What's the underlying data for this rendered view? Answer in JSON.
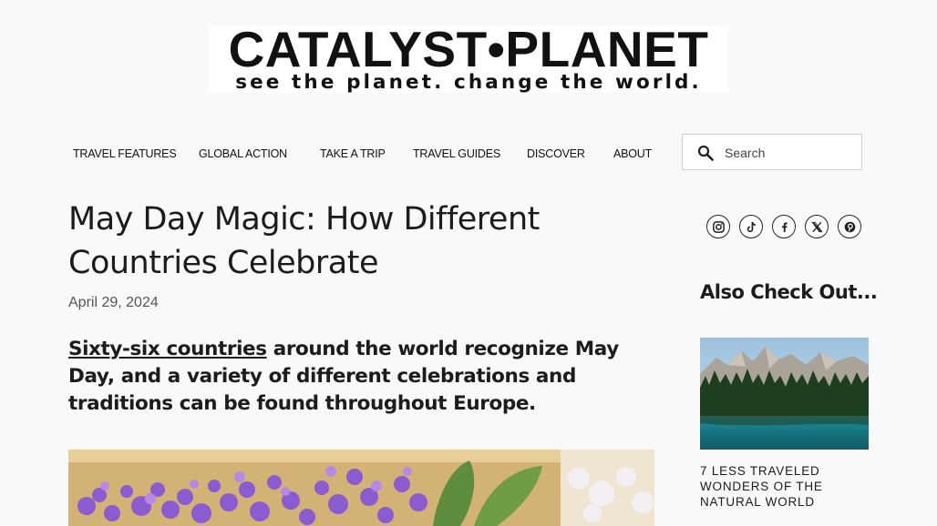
{
  "logo": {
    "title": "CATALYST•PLANET",
    "tagline": "see the planet. change the world."
  },
  "nav": {
    "items": [
      "TRAVEL FEATURES",
      "GLOBAL ACTION",
      "TAKE A TRIP",
      "TRAVEL GUIDES",
      "DISCOVER",
      "ABOUT"
    ]
  },
  "search": {
    "placeholder": "Search",
    "icon": "search-icon"
  },
  "article": {
    "title": "May Day Magic: How Different Countries Celebrate",
    "date": "April 29, 2024",
    "lead_link": "Sixty-six countries",
    "lead_rest": " around the world recognize May Day, and a variety of different celebrations and traditions can be found throughout Europe."
  },
  "social": {
    "icons": [
      "instagram-icon",
      "tiktok-icon",
      "facebook-icon",
      "x-icon",
      "pinterest-icon"
    ]
  },
  "sidebar": {
    "heading": "Also Check Out...",
    "card_title": "7 Less Traveled Wonders of the Natural World"
  },
  "colors": {
    "text": "#1c1c1c",
    "background": "#f9f9f9",
    "border": "#cfcfcf"
  }
}
